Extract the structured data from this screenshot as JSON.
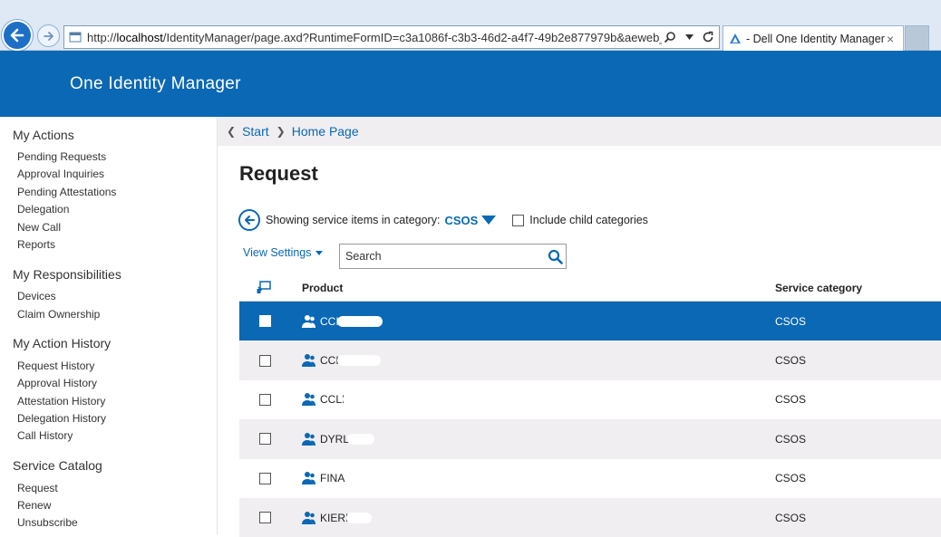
{
  "browser": {
    "url_prefix": "http://",
    "url_host": "localhost",
    "url_path": "/IdentityManager/page.axd?RuntimeFormID=c3a1086f-c3b3-46d2-a4f7-49b2e877979b&aeweb_handler=p&",
    "tab_title": "- Dell One Identity Manager",
    "tab_close": "×"
  },
  "header": {
    "title": "One Identity Manager"
  },
  "sidebar": {
    "sections": [
      {
        "title": "My Actions",
        "items": [
          "Pending Requests",
          "Approval Inquiries",
          "Pending Attestations",
          "Delegation",
          "New Call",
          "Reports"
        ]
      },
      {
        "title": "My Responsibilities",
        "items": [
          "Devices",
          "Claim Ownership"
        ]
      },
      {
        "title": "My Action History",
        "items": [
          "Request History",
          "Approval History",
          "Attestation History",
          "Delegation History",
          "Call History"
        ]
      },
      {
        "title": "Service Catalog",
        "items": [
          "Request",
          "Renew",
          "Unsubscribe"
        ]
      }
    ]
  },
  "breadcrumb": {
    "start": "Start",
    "home": "Home Page"
  },
  "page": {
    "title": "Request",
    "category_prefix": "Showing service items in category:",
    "category": "CSOS",
    "include_child": "Include child categories",
    "view_settings": "View Settings",
    "search_placeholder": "Search"
  },
  "grid": {
    "col_product": "Product",
    "col_category": "Service category",
    "rows": [
      {
        "product": "CCI",
        "category": "CSOS",
        "selected": true
      },
      {
        "product": "CCI",
        "category": "CSOS",
        "selected": false
      },
      {
        "product": "CCLI",
        "category": "CSOS",
        "selected": false
      },
      {
        "product": "DYRL",
        "category": "CSOS",
        "selected": false
      },
      {
        "product": "FINA",
        "category": "CSOS",
        "selected": false
      },
      {
        "product": "KIERI",
        "category": "CSOS",
        "selected": false
      }
    ]
  },
  "colors": {
    "brand": "#0a68b4",
    "row_alt": "#f0eef1"
  }
}
